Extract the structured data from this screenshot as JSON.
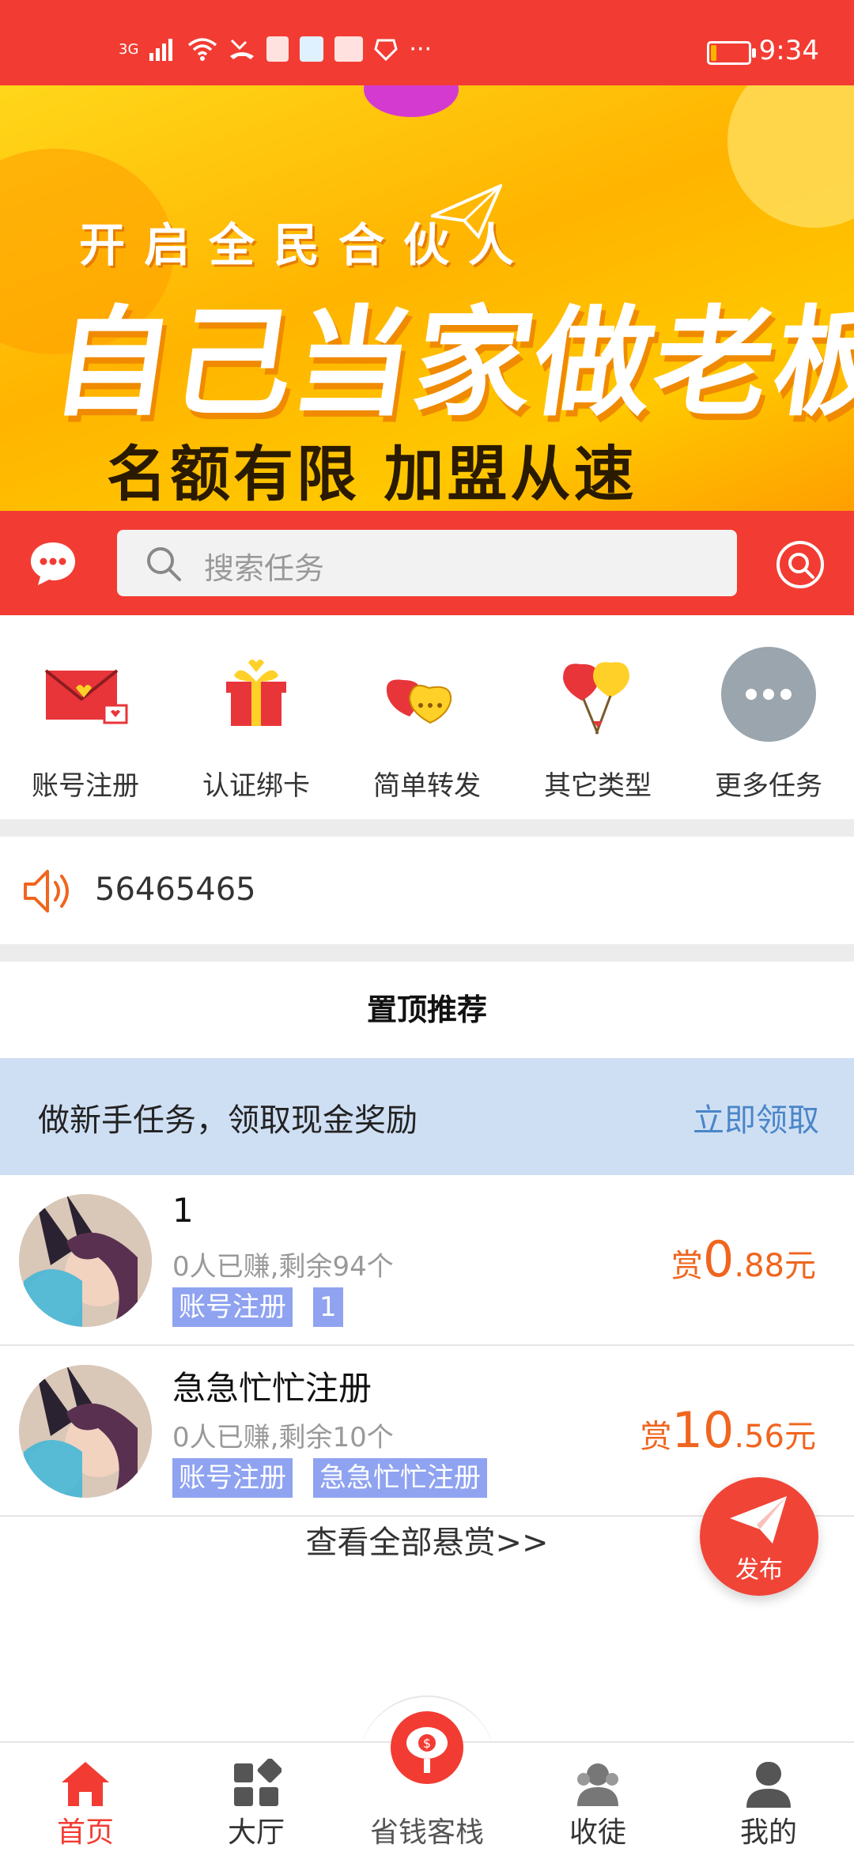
{
  "status_bar": {
    "network": "3G",
    "time": "9:34",
    "battery_level": 0.15,
    "more": "···"
  },
  "banner": {
    "line1": "开启全民合伙人",
    "line2": "自己当家做老板",
    "line3": "名额有限  加盟从速",
    "page_count": 2,
    "active_page": 1
  },
  "search": {
    "placeholder": "搜索任务"
  },
  "categories": [
    {
      "label": "账号注册",
      "icon": "envelope-icon"
    },
    {
      "label": "认证绑卡",
      "icon": "gift-icon"
    },
    {
      "label": "简单转发",
      "icon": "hearts-icon"
    },
    {
      "label": "其它类型",
      "icon": "balloons-icon"
    },
    {
      "label": "更多任务",
      "icon": "more-icon"
    }
  ],
  "notice": {
    "text": "56465465"
  },
  "recommend": {
    "title": "置顶推荐",
    "promo_text": "做新手任务，领取现金奖励",
    "promo_link": "立即领取"
  },
  "tasks": [
    {
      "name": "1",
      "meta": "0人已赚,剩余94个",
      "tags": [
        "账号注册",
        "1"
      ],
      "reward_prefix": "赏",
      "reward_int": "0",
      "reward_dec": ".88元"
    },
    {
      "name": "急急忙忙注册",
      "meta": "0人已赚,剩余10个",
      "tags": [
        "账号注册",
        "急急忙忙注册"
      ],
      "reward_prefix": "赏",
      "reward_int": "10",
      "reward_dec": ".56元"
    }
  ],
  "view_all": "查看全部悬赏>>",
  "fab": {
    "label": "发布"
  },
  "bottom_nav": [
    {
      "label": "首页",
      "icon": "home-icon",
      "active": true
    },
    {
      "label": "大厅",
      "icon": "grid-icon",
      "active": false
    },
    {
      "label": "省钱客栈",
      "icon": "lantern-icon",
      "active": false
    },
    {
      "label": "收徒",
      "icon": "users-icon",
      "active": false
    },
    {
      "label": "我的",
      "icon": "user-icon",
      "active": false
    }
  ],
  "colors": {
    "primary_red": "#f23c33",
    "reward_orange": "#f0651f",
    "tag_blue": "#8fa3f0",
    "link_blue": "#4a86c8",
    "promo_bg": "#cfdff3"
  }
}
